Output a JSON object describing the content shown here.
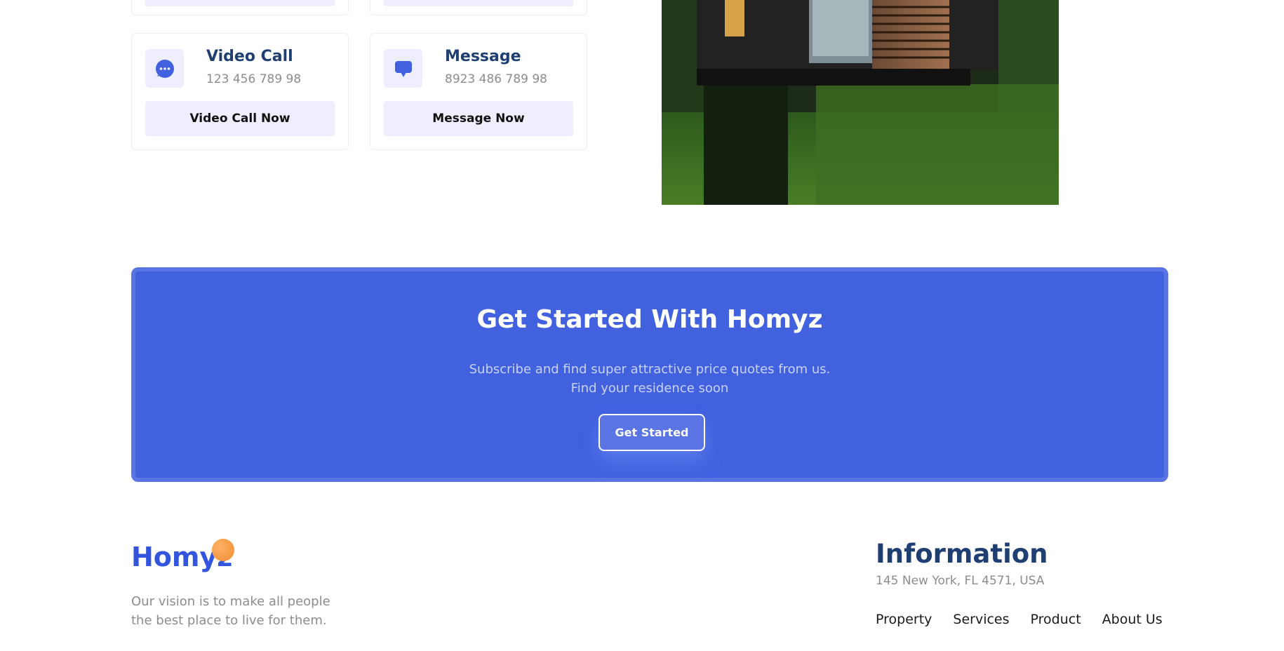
{
  "contact": {
    "cards": [
      {
        "title": "Video Call",
        "value": "123 456 789 98",
        "button": "Video Call Now",
        "icon": "chat-bubble-dots-icon"
      },
      {
        "title": "Message",
        "value": "8923 486 789 98",
        "button": "Message Now",
        "icon": "message-bubble-icon"
      }
    ]
  },
  "banner": {
    "title": "Get Started With Homyz",
    "text_line1": "Subscribe and find super attractive price quotes from us.",
    "text_line2": "Find your residence soon",
    "button": "Get Started"
  },
  "footer": {
    "logo": "Homyz",
    "vision_line1": "Our vision is to make all people",
    "vision_line2": "the best place to live for them.",
    "info_title": "Information",
    "address": "145 New York, FL 4571, USA",
    "menu": [
      "Property",
      "Services",
      "Product",
      "About Us"
    ]
  },
  "colors": {
    "primary": "#4161df",
    "heading": "#1f3e72",
    "muted": "#8c8c8c",
    "soft": "#eeeeff",
    "logo": "#3355dd",
    "accent": "#f08e2f"
  }
}
